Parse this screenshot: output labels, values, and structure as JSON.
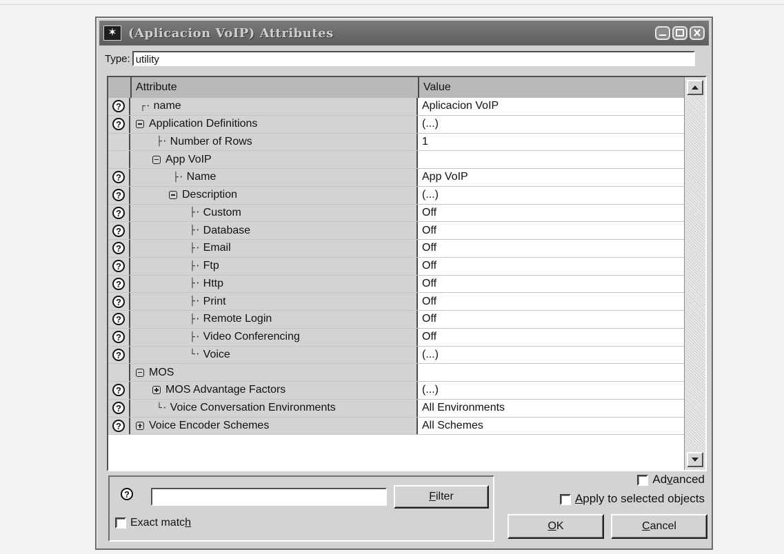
{
  "window": {
    "title": "(Aplicacion VoIP) Attributes",
    "icon": "star-icon"
  },
  "type_row": {
    "label": "Type:",
    "value": "utility"
  },
  "table": {
    "headers": {
      "attribute": "Attribute",
      "value": "Value"
    },
    "rows": [
      {
        "attr": "name",
        "value": "Aplicacion VoIP",
        "help": true,
        "tree": "┌·",
        "indent": 0,
        "expander": ""
      },
      {
        "attr": "Application Definitions",
        "value": "(...)",
        "help": true,
        "tree": "",
        "indent": 0,
        "expander": "minus"
      },
      {
        "attr": "Number of Rows",
        "value": "1",
        "help": false,
        "tree": "├·",
        "indent": 1,
        "expander": ""
      },
      {
        "attr": "App VoIP",
        "value": "",
        "help": false,
        "tree": "",
        "indent": 1,
        "expander": "minus"
      },
      {
        "attr": "Name",
        "value": "App VoIP",
        "help": true,
        "tree": "├·",
        "indent": 2,
        "expander": ""
      },
      {
        "attr": "Description",
        "value": "(...)",
        "help": true,
        "tree": "",
        "indent": 2,
        "expander": "minus"
      },
      {
        "attr": "Custom",
        "value": "Off",
        "help": true,
        "tree": "├·",
        "indent": 3,
        "expander": ""
      },
      {
        "attr": "Database",
        "value": "Off",
        "help": true,
        "tree": "├·",
        "indent": 3,
        "expander": ""
      },
      {
        "attr": "Email",
        "value": "Off",
        "help": true,
        "tree": "├·",
        "indent": 3,
        "expander": ""
      },
      {
        "attr": "Ftp",
        "value": "Off",
        "help": true,
        "tree": "├·",
        "indent": 3,
        "expander": ""
      },
      {
        "attr": "Http",
        "value": "Off",
        "help": true,
        "tree": "├·",
        "indent": 3,
        "expander": ""
      },
      {
        "attr": "Print",
        "value": "Off",
        "help": true,
        "tree": "├·",
        "indent": 3,
        "expander": ""
      },
      {
        "attr": "Remote Login",
        "value": "Off",
        "help": true,
        "tree": "├·",
        "indent": 3,
        "expander": ""
      },
      {
        "attr": "Video Conferencing",
        "value": "Off",
        "help": true,
        "tree": "├·",
        "indent": 3,
        "expander": ""
      },
      {
        "attr": "Voice",
        "value": "(...)",
        "help": true,
        "tree": "└·",
        "indent": 3,
        "expander": ""
      },
      {
        "attr": "MOS",
        "value": "",
        "help": false,
        "tree": "",
        "indent": 0,
        "expander": "minus"
      },
      {
        "attr": "MOS Advantage Factors",
        "value": "(...)",
        "help": true,
        "tree": "",
        "indent": 1,
        "expander": "plus"
      },
      {
        "attr": "Voice Conversation Environments",
        "value": "All Environments",
        "help": true,
        "tree": "└·",
        "indent": 1,
        "expander": ""
      },
      {
        "attr": "Voice Encoder Schemes",
        "value": "All Schemes",
        "help": true,
        "tree": "",
        "indent": 0,
        "expander": "plus"
      }
    ]
  },
  "filter": {
    "input_value": "",
    "filter_button": "Filter",
    "filter_button_key": "F",
    "exact_match": "Exact match",
    "exact_match_key": "h"
  },
  "options": {
    "advanced": "Advanced",
    "advanced_key": "v",
    "apply": "Apply to selected objects",
    "apply_key": "A"
  },
  "buttons": {
    "ok": "OK",
    "ok_key": "O",
    "cancel": "Cancel",
    "cancel_key": "C"
  },
  "help_glyph": "?"
}
